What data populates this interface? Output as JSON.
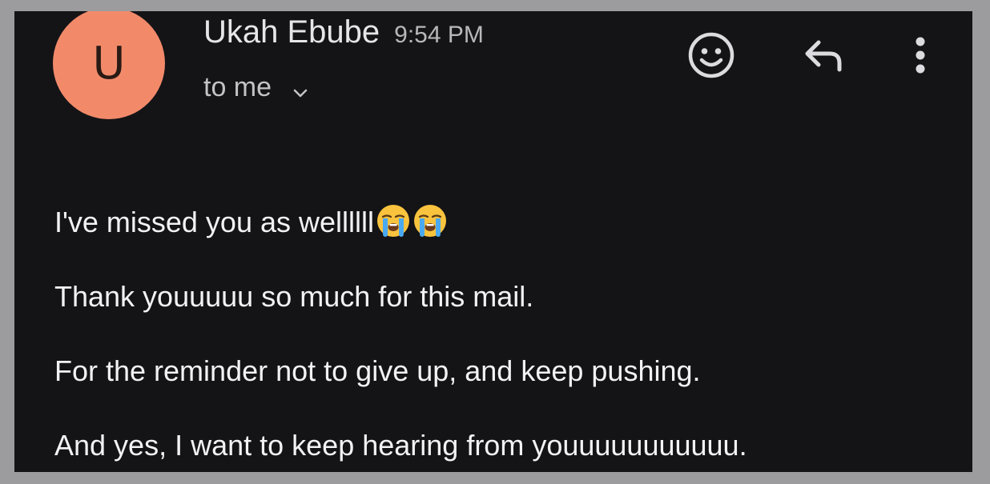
{
  "message": {
    "avatar_letter": "U",
    "sender_name": "Ukah Ebube",
    "time": "9:54 PM",
    "recipient_label": "to me",
    "avatar_color": "#f28a6a"
  },
  "actions": {
    "emoji_icon": "add-reaction-icon",
    "reply_icon": "reply-icon",
    "more_icon": "more-vertical-icon"
  },
  "body": {
    "lines": [
      "I've missed you as wellllll",
      "Thank youuuuu so much for this mail.",
      "For the reminder not to give up, and keep pushing.",
      "And yes, I want to keep hearing from youuuuuuuuuuu."
    ],
    "line1_emojis": [
      "loudly-crying-face",
      "loudly-crying-face"
    ]
  },
  "colors": {
    "background": "#141416",
    "text": "#f2f2f4",
    "muted": "#b8b8bc"
  }
}
